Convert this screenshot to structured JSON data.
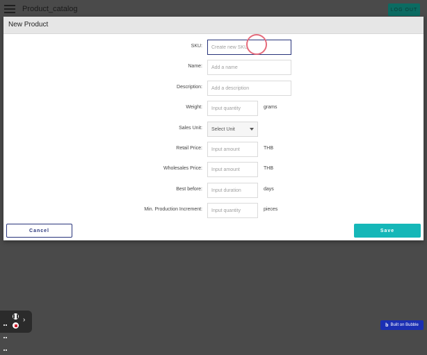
{
  "app": {
    "title": "Product_catalog",
    "logout_label": "LOG OUT"
  },
  "modal": {
    "title": "New Product",
    "fields": [
      {
        "label": "SKU:",
        "placeholder": "Create new SKU",
        "unit": ""
      },
      {
        "label": "Name:",
        "placeholder": "Add a name",
        "unit": ""
      },
      {
        "label": "Description:",
        "placeholder": "Add a description",
        "unit": ""
      },
      {
        "label": "Weight:",
        "placeholder": "Input quantity",
        "unit": "grams"
      },
      {
        "label": "Sales Unit:",
        "placeholder": "Select Unit",
        "unit": ""
      },
      {
        "label": "Retail Price:",
        "placeholder": "Input amount",
        "unit": "THB"
      },
      {
        "label": "Wholesales Price:",
        "placeholder": "Input amount",
        "unit": "THB"
      },
      {
        "label": "Best before:",
        "placeholder": "Input duration",
        "unit": "days"
      },
      {
        "label": "Min. Production Increment:",
        "placeholder": "Input quantity",
        "unit": "pieces"
      }
    ],
    "cancel_label": "Cancel",
    "save_label": "Save"
  },
  "debugger": {
    "pause_icon": "pause-icon",
    "stop_icon": "stop-icon",
    "expand_icon": "chevron-right-icon"
  },
  "badge": {
    "label": "Built on Bubble"
  },
  "colors": {
    "accent": "#15b7b8",
    "navy": "#27337a",
    "backdrop": "#4a4a4a"
  }
}
